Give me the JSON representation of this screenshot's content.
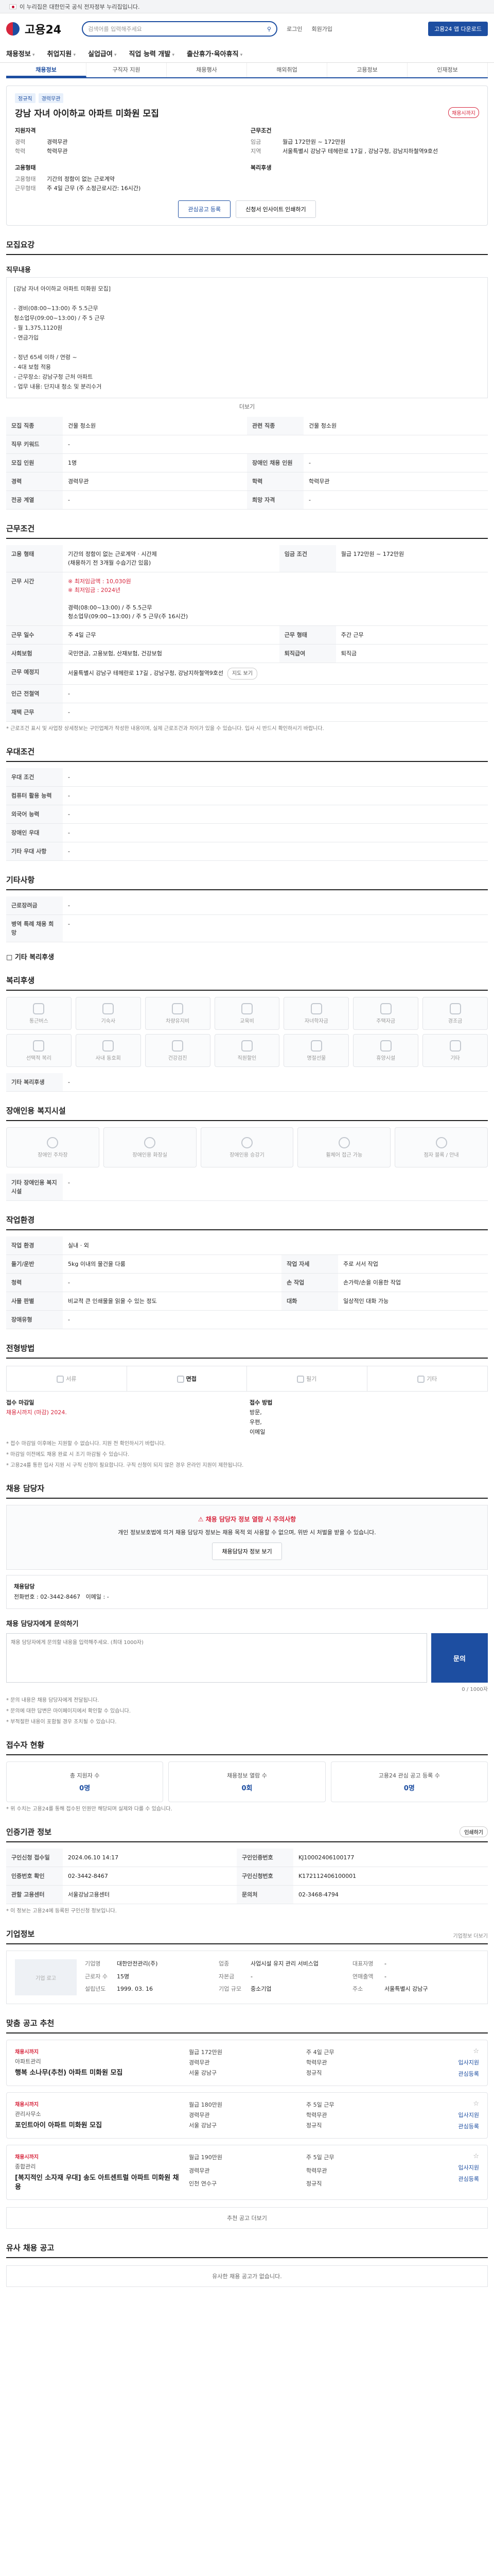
{
  "topbar": {
    "text": "이 누리집은 대한민국 공식 전자정부 누리집입니다."
  },
  "header": {
    "logo": "고용24",
    "search_placeholder": "검색어를 입력해주세요",
    "login": "로그인",
    "join": "회원가입",
    "cta": "고용24 앱 다운로드"
  },
  "gnb": [
    "채용정보",
    "취업지원",
    "실업급여",
    "직업 능력 개발",
    "출산휴가·육아휴직"
  ],
  "subnav": [
    {
      "label": "채용정보",
      "active": true
    },
    {
      "label": "구직자 지원",
      "active": false
    },
    {
      "label": "채용행사",
      "active": false
    },
    {
      "label": "해외취업",
      "active": false
    },
    {
      "label": "고용정보",
      "active": false
    },
    {
      "label": "인재정보",
      "active": false
    }
  ],
  "job": {
    "badges": [
      "정규직",
      "경력무관"
    ],
    "title": "강남 자녀 아이하교 아파트 미화원 모집",
    "deadline": "채용시까지",
    "left_heading": "지원자격",
    "left": [
      {
        "k": "경력",
        "v": "경력무관"
      },
      {
        "k": "학력",
        "v": "학력무관"
      }
    ],
    "right_heading": "근무조건",
    "right": [
      {
        "k": "임금",
        "v": "월급 172만원 ~ 172만원"
      },
      {
        "k": "지역",
        "v": "서울특별시 강남구 테헤란로 17길 , 강남구청, 강남지하철역9호선"
      }
    ],
    "left2_heading": "고용형태",
    "left2": [
      {
        "k": "고용형태",
        "v": "기간의 정함이 없는 근로계약"
      },
      {
        "k": "근무형태",
        "v": "주 4일 근무 (주 소정근로시간: 16시간)"
      }
    ],
    "right2_heading": "복리후생",
    "right2": [],
    "apply_btn": "관심공고 등록",
    "share_btn": "신청서 인사이트 인쇄하기"
  },
  "recruit": {
    "title": "모집요강",
    "content_title": "직무내용",
    "content": "[강남 자녀 아이하교 아파트 미화원 모집]\n\n- 경비(08:00~13:00) 주 5.5근무\n  청소업무(09:00~13:00) / 주 5 근무\n- 월 1,375,1120원\n- 연금가입\n\n- 정년 65세 이하 / 연령 ~\n- 4대 보험 적용\n- 근무장소: 강남구청 근처 아파트\n- 업무 내용: 단지내 청소 및 분리수거",
    "more": "더보기",
    "table": [
      {
        "k": "모집 직종",
        "v": "건물 청소원"
      },
      {
        "k": "관련 직종",
        "v": "건물 청소원"
      },
      {
        "k": "직무 키워드",
        "v": "-"
      },
      {
        "k": "모집 인원",
        "v": "1명"
      },
      {
        "k": "경력",
        "v": "경력무관"
      },
      {
        "k": "학력",
        "v": "학력무관"
      },
      {
        "k": "전공 계열",
        "v": "-"
      }
    ],
    "table_extra": [
      {
        "k": "장애인 채용 인원",
        "v": "-"
      },
      {
        "k": "희망 자격",
        "v": "-"
      }
    ]
  },
  "conditions": {
    "title": "근무조건",
    "employment_type": "기간의 정함이 없는 근로계약 · 시간제\n(채용하기 전 3개월 수습기간 있음)",
    "wage": "월급 172만원 ~ 172만원",
    "wage_note": "※ 최저임금액 : 10,030원\n※ 최저임금 : 2024년",
    "worktime": "경력(08:00~13:00) / 주 5.5근무\n청소업무(09:00~13:00) / 주 5 근무(주 16시간)",
    "worktime_label": "근무 시간",
    "weekly_days": "주 4일 근무",
    "shift": "주간 근무",
    "social_insurance": "국민연금, 고용보험, 산재보험, 건강보험",
    "retirement": "퇴직금",
    "location": "서울특별시 강남구 테헤란로 17길 , 강남구청, 강남지하철역9호선",
    "map_btn": "지도 보기",
    "nearby": "-",
    "parking": "-",
    "note": "* 근로조건 표시 및 사업장 상세정보는 구인업체가 작성한 내용이며, 실제 근로조건과 차이가 있을 수 있습니다. 입사 시 반드시 확인하시기 바랍니다.",
    "labels": {
      "type": "고용 형태",
      "wage": "임금 조건",
      "days": "근무 일수",
      "shift": "근무 형태",
      "insurance": "사회보험",
      "retire": "퇴직급여",
      "loc": "근무 예정지",
      "nearby": "인근 전철역",
      "parking": "재택 근무"
    }
  },
  "preference": {
    "title": "우대조건",
    "items": [
      {
        "k": "우대 조건",
        "v": "-"
      },
      {
        "k": "컴퓨터 활용 능력",
        "v": "-"
      },
      {
        "k": "외국어 능력",
        "v": "-"
      },
      {
        "k": "장애인 우대",
        "v": "-"
      },
      {
        "k": "기타 우대 사항",
        "v": "-"
      }
    ]
  },
  "etc": {
    "title": "기타사항",
    "items": [
      {
        "k": "근로장려금",
        "v": "-"
      },
      {
        "k": "병역 특례 채용 희망",
        "v": "-"
      }
    ],
    "more": "기타 복리후생"
  },
  "welfare": {
    "title": "복리후생",
    "items": [
      "통근버스",
      "기숙사",
      "차량유지비",
      "교육비",
      "자녀학자금",
      "주택자금",
      "경조금",
      "선택적 복리",
      "사내 동호회",
      "건강검진",
      "직원할인",
      "명절선물",
      "휴양시설",
      "기타"
    ],
    "more_label": "기타 복리후생",
    "more_value": "-"
  },
  "disability": {
    "title": "장애인용 복지시설",
    "items": [
      "장애인 주차장",
      "장애인용 화장실",
      "장애인용 승강기",
      "휠체어 접근 가능",
      "점자 블록 / 안내"
    ],
    "other_label": "기타 장애인용 복지시설",
    "other_value": "-"
  },
  "company_place": {
    "title": "작업환경",
    "items": [
      {
        "k": "작업 환경",
        "v": "실내 · 외"
      },
      {
        "k": "들기/운반",
        "v": "5kg 이내의 물건을 다룸"
      },
      {
        "k": "작업 자세",
        "v": "주로 서서 작업"
      },
      {
        "k": "청력",
        "v": "-"
      },
      {
        "k": "손 작업",
        "v": "손가락/손을 이용한 작업"
      },
      {
        "k": "사물 판별",
        "v": "비교적 큰 인쇄물을 읽을 수 있는 정도"
      },
      {
        "k": "대화",
        "v": "일상적인 대화 가능"
      },
      {
        "k": "장애유형",
        "v": "-"
      }
    ]
  },
  "process": {
    "title": "전형방법",
    "steps": [
      "서류",
      "면접",
      "필기",
      "기타"
    ],
    "deadline_label": "접수 마감일",
    "deadline_value": "채용시까지 (마감) 2024.",
    "method_label": "접수 방법",
    "method_value": "방문,\n우편,\n이메일",
    "notes": [
      "* 접수 마감일 이후에는 지원할 수 없습니다. 지원 전 확인하시기 바랍니다.",
      "* 마감일 이전에도 채용 완료 시 조기 마감될 수 있습니다.",
      "* 고용24를 통한 입사 지원 시 구직 신청이 필요합니다. 구직 신청이 되지 않은 경우 온라인 지원이 제한됩니다."
    ]
  },
  "contact": {
    "title": "채용 담당자",
    "warn": "채용 담당자 정보 열람 시 주의사항",
    "warn_text": "개인 정보보호법에 의거 채용 담당자 정보는 채용 목적 외 사용할 수 없으며, 위반 시 처벌을 받을 수 있습니다.",
    "reveal_btn": "채용담당자 정보 보기",
    "box_title": "채용담당",
    "phone_label": "전화번호",
    "phone": "02-3442-8467",
    "email_label": "이메일",
    "inquiry_title": "채용 담당자에게 문의하기",
    "inquiry_placeholder": "채용 담당자에게 문의할 내용을 입력해주세요. (최대 1000자)",
    "inquiry_count": "0 / 1000자",
    "send": "문의",
    "inquiry_notes": [
      "* 문의 내용은 채용 담당자에게 전달됩니다.",
      "* 문의에 대한 답변은 마이페이지에서 확인할 수 있습니다.",
      "* 부적절한 내용이 포함될 경우 조치될 수 있습니다."
    ]
  },
  "stats": {
    "title": "접수자 현황",
    "items": [
      {
        "label": "총 지원자 수",
        "value": "0명"
      },
      {
        "label": "채용정보 열람 수",
        "value": "0회"
      },
      {
        "label": "고용24 관심 공고 등록 수",
        "value": "0명"
      }
    ],
    "note": "* 위 수치는 고용24를 통해 접수된 인원만 해당되며 실제와 다를 수 있습니다."
  },
  "info": {
    "title": "인증기관 정보",
    "print_btn": "인쇄하기",
    "items": [
      {
        "k": "구인신청 접수일",
        "v": "2024.06.10 14:17"
      },
      {
        "k": "구인인증번호",
        "v": "KJ10002406100177"
      },
      {
        "k": "인증번호 확인",
        "v": "02-3442-8467"
      },
      {
        "k": "구인신청번호",
        "v": "K172112406100001"
      },
      {
        "k": "관할 고용센터",
        "v": "서울강남고용센터"
      },
      {
        "k": "문의처",
        "v": "02-3468-4794"
      }
    ],
    "note": "* 이 정보는 고용24에 등록된 구인신청 정보입니다."
  },
  "company": {
    "title": "기업정보",
    "more": "기업정보 더보기",
    "logo_alt": "기업 로고",
    "fields": [
      {
        "k": "기업명",
        "v": "대한안전관리(주)"
      },
      {
        "k": "업종",
        "v": "사업시설 유지 관리 서비스업"
      },
      {
        "k": "대표자명",
        "v": "-"
      },
      {
        "k": "근로자 수",
        "v": "15명"
      },
      {
        "k": "자본금",
        "v": "-"
      },
      {
        "k": "연매출액",
        "v": "-"
      },
      {
        "k": "설립년도",
        "v": "1999. 03. 16"
      },
      {
        "k": "기업 규모",
        "v": "중소기업"
      },
      {
        "k": "주소",
        "v": "서울특별시 강남구"
      }
    ]
  },
  "recommended": {
    "title": "맞춤 공고 추천",
    "items": [
      {
        "tag": "채용시까지",
        "company": "아파트관리",
        "title": "행복 소나무(추천) 아파트 미화원 모집",
        "info": [
          "월급 172만원",
          "주 4일 근무",
          "경력무관",
          "학력무관",
          "서울 강남구",
          "정규직"
        ],
        "apply": "입사지원",
        "interest": "관심등록"
      },
      {
        "tag": "채용시까지",
        "company": "관리사무소",
        "title": "포인트아이 아파트 미화원 모집",
        "info": [
          "월급 180만원",
          "주 5일 근무",
          "경력무관",
          "학력무관",
          "서울 강남구",
          "정규직"
        ],
        "apply": "입사지원",
        "interest": "관심등록"
      },
      {
        "tag": "채용시까지",
        "company": "종합관리",
        "title": "[복지적인 소자재 우대] 송도 아트센트럴 아파트 미화원 채용",
        "info": [
          "월급 190만원",
          "주 5일 근무",
          "경력무관",
          "학력무관",
          "인천 연수구",
          "정규직"
        ],
        "apply": "입사지원",
        "interest": "관심등록"
      }
    ],
    "more": "추천 공고 더보기"
  },
  "similar": {
    "title": "유사 채용 공고",
    "empty": "유사한 채용 공고가 없습니다."
  }
}
